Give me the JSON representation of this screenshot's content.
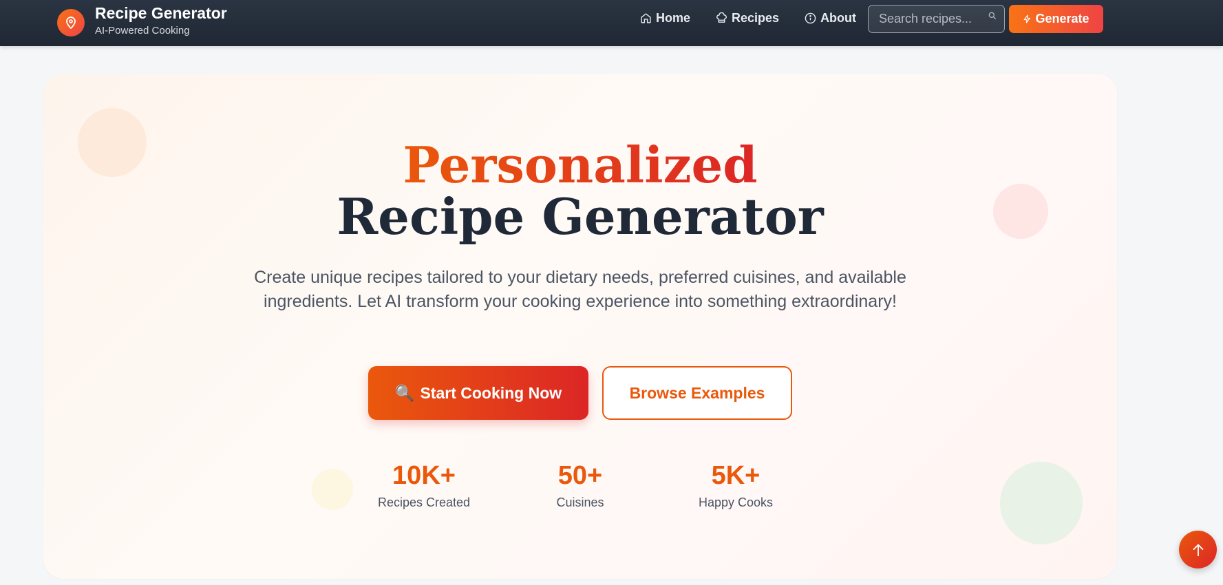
{
  "brand": {
    "title": "Recipe Generator",
    "subtitle": "AI-Powered Cooking",
    "logo_icon": "location-pin-icon"
  },
  "nav": {
    "links": [
      {
        "label": "Home",
        "icon": "home-icon"
      },
      {
        "label": "Recipes",
        "icon": "chef-hat-icon"
      },
      {
        "label": "About",
        "icon": "info-icon"
      }
    ],
    "search": {
      "placeholder": "Search recipes...",
      "value": ""
    },
    "generate_label": "Generate"
  },
  "hero": {
    "title_line1": "Personalized",
    "title_line2": "Recipe Generator",
    "description": "Create unique recipes tailored to your dietary needs, preferred cuisines, and available ingredients. Let AI transform your cooking experience into something extraordinary!",
    "primary_button": {
      "emoji": "🔍",
      "label": "Start Cooking Now"
    },
    "secondary_button": {
      "label": "Browse Examples"
    },
    "stats": [
      {
        "value": "10K+",
        "label": "Recipes Created"
      },
      {
        "value": "50+",
        "label": "Cuisines"
      },
      {
        "value": "5K+",
        "label": "Happy Cooks"
      }
    ]
  },
  "colors": {
    "accent_orange": "#ea580c",
    "accent_red": "#dc2626",
    "navbar_dark": "#1f2733",
    "heading_dark": "#1f2937"
  }
}
